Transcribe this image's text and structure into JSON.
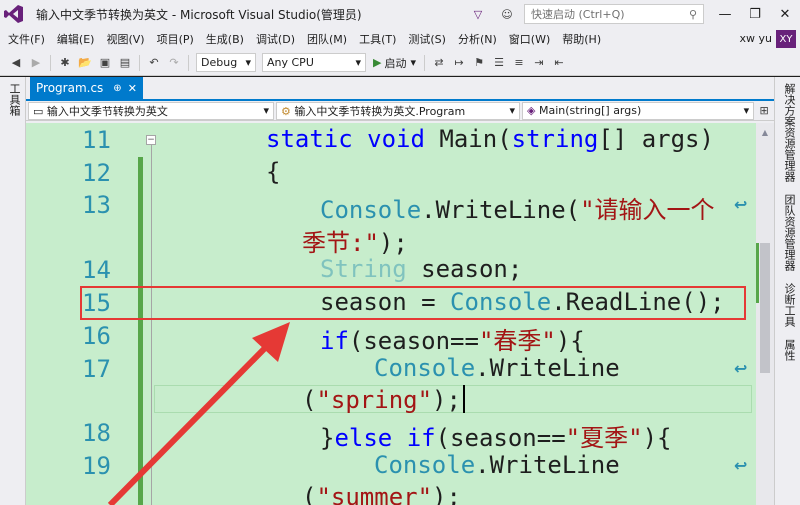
{
  "window": {
    "title": "输入中文季节转换为英文 - Microsoft Visual Studio(管理员)",
    "quick_launch_placeholder": "快速启动 (Ctrl+Q)",
    "minimize": "—",
    "restore": "❐",
    "close": "✕"
  },
  "menu": {
    "items": [
      "文件(F)",
      "编辑(E)",
      "视图(V)",
      "项目(P)",
      "生成(B)",
      "调试(D)",
      "团队(M)",
      "工具(T)",
      "测试(S)",
      "分析(N)",
      "窗口(W)",
      "帮助(H)"
    ],
    "user": "xw yu",
    "avatar": "XY"
  },
  "toolbar": {
    "config": "Debug",
    "platform": "Any CPU",
    "start": "启动"
  },
  "left_tool": "工具箱",
  "right_tools": [
    "解决方案资源管理器",
    "团队资源管理器",
    "诊断工具",
    "属性"
  ],
  "tab": {
    "label": "Program.cs",
    "pin": "⊕",
    "close": "✕"
  },
  "navbar": {
    "project": "输入中文季节转换为英文",
    "class": "输入中文季节转换为英文.Program",
    "member": "Main(string[] args)"
  },
  "editor": {
    "line_numbers": [
      "11",
      "12",
      "13",
      "14",
      "15",
      "16",
      "17",
      "18",
      "19"
    ],
    "code": {
      "l11_a": "static",
      "l11_b": "void",
      "l11_c": "Main(",
      "l11_d": "string",
      "l11_e": "[] args)",
      "l12": "{",
      "l13_a": "Console",
      "l13_b": ".WriteLine(",
      "l13_c": "\"请输入一个",
      "l13w_a": "季节:\"",
      "l13w_b": ");",
      "l14_a": "String",
      "l14_b": " season;",
      "l15_a": "season = ",
      "l15_b": "Console",
      "l15_c": ".ReadLine();",
      "l16_a": "if",
      "l16_b": "(season==",
      "l16_c": "\"春季\"",
      "l16_d": "){",
      "l17_a": "Console",
      "l17_b": ".WriteLine",
      "l17w_a": "(",
      "l17w_b": "\"spring\"",
      "l17w_c": ");",
      "l18_a": "}",
      "l18_b": "else",
      "l18_c": " ",
      "l18_d": "if",
      "l18_e": "(season==",
      "l18_f": "\"夏季\"",
      "l18_g": "){",
      "l19_a": "Console",
      "l19_b": ".WriteLine",
      "l19w_a": "(",
      "l19w_b": "\"summer\"",
      "l19w_c": ");"
    }
  },
  "colors": {
    "editor_bg": "#c7edcc",
    "accent": "#007acc",
    "keyword": "#0000ff",
    "type": "#2b91af",
    "string": "#a31515",
    "annotation": "#e53935"
  }
}
